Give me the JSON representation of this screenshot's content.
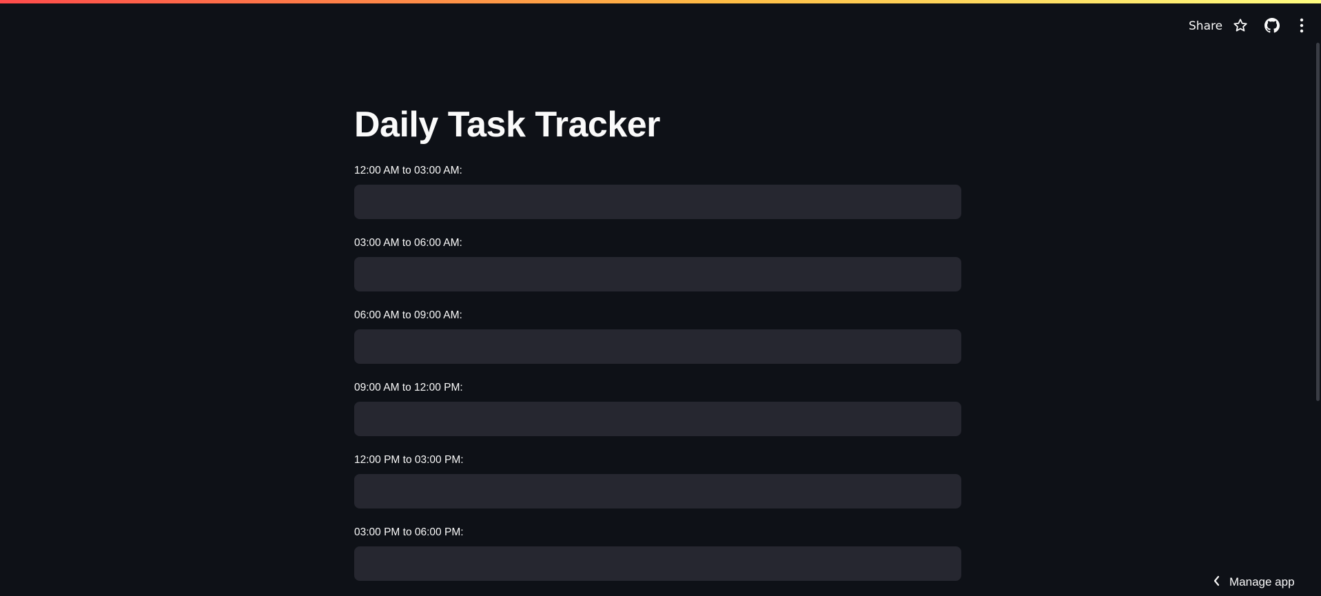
{
  "header": {
    "share_label": "Share",
    "icons": [
      "star-icon",
      "github-icon",
      "more-vertical-icon"
    ]
  },
  "main": {
    "title": "Daily Task Tracker",
    "fields": [
      {
        "label": "12:00 AM to 03:00 AM:",
        "value": ""
      },
      {
        "label": "03:00 AM to 06:00 AM:",
        "value": ""
      },
      {
        "label": "06:00 AM to 09:00 AM:",
        "value": ""
      },
      {
        "label": "09:00 AM to 12:00 PM:",
        "value": ""
      },
      {
        "label": "12:00 PM to 03:00 PM:",
        "value": ""
      },
      {
        "label": "03:00 PM to 06:00 PM:",
        "value": ""
      }
    ]
  },
  "footer": {
    "manage_app_label": "Manage app"
  },
  "colors": {
    "background": "#0e1117",
    "input_background": "#262730",
    "text": "#fafafa",
    "accent_gradient_start": "#ff4b4b",
    "accent_gradient_end": "#fffd80"
  }
}
